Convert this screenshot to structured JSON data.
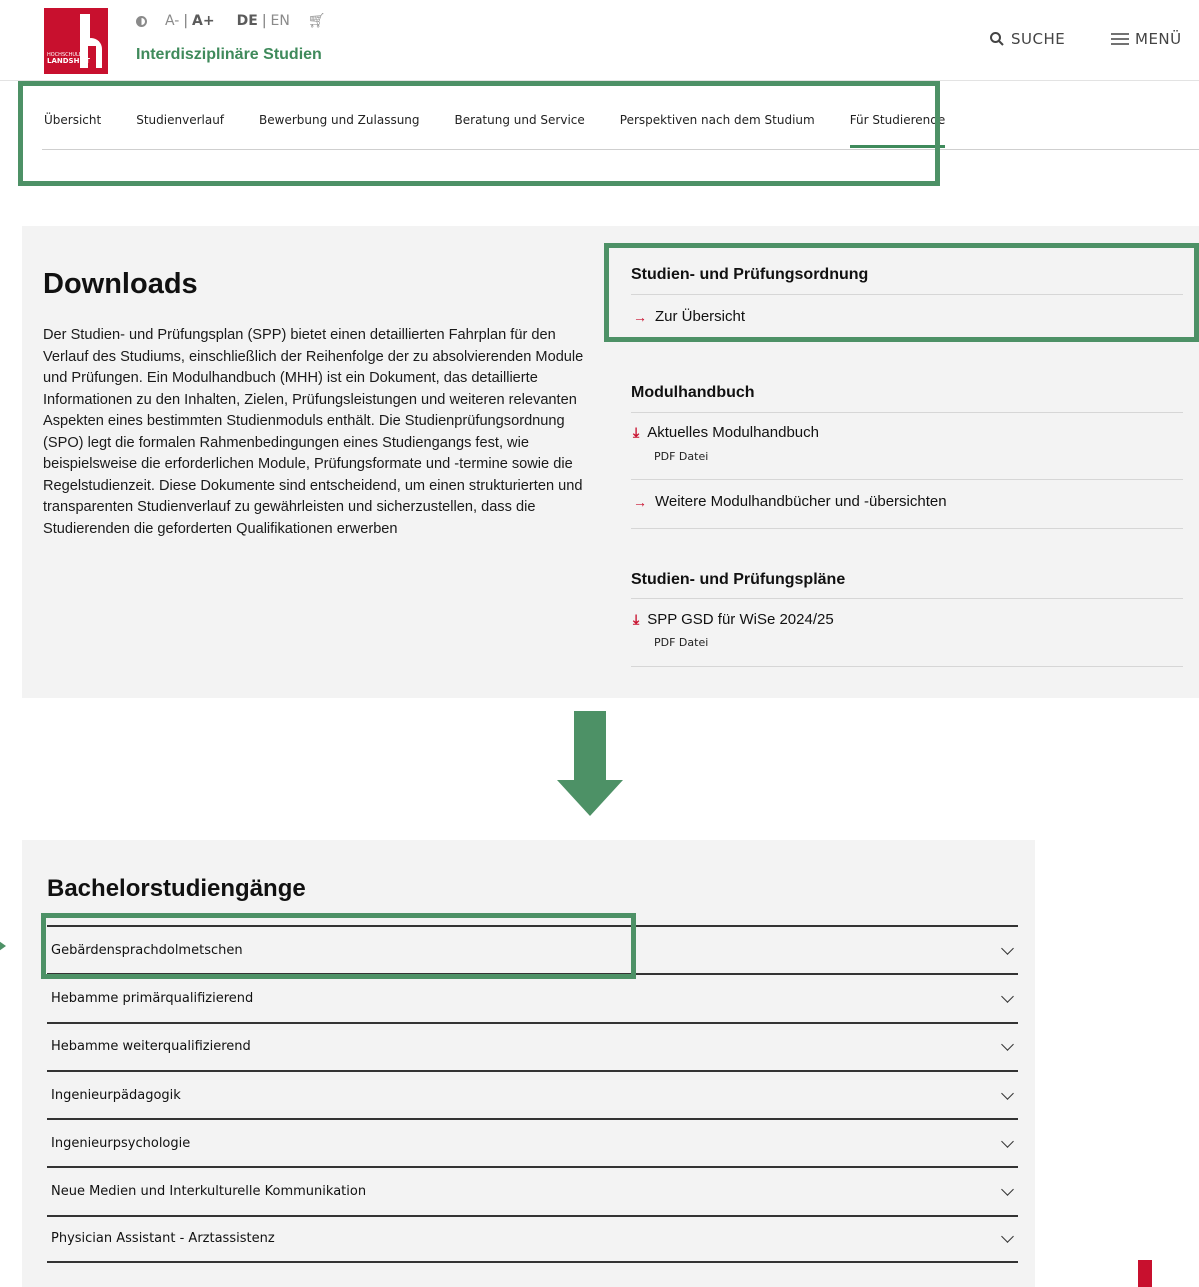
{
  "header": {
    "logo_text_line1": "HOCHSCHULE",
    "logo_text_line2": "LANDSHUT",
    "font_decrease": "A-",
    "font_increase": "A+",
    "lang_de": "DE",
    "lang_en": "EN",
    "site_title": "Interdisziplinäre Studien",
    "search_label": "SUCHE",
    "menu_label": "MENÜ"
  },
  "nav": {
    "items": [
      {
        "label": "Übersicht"
      },
      {
        "label": "Studienverlauf"
      },
      {
        "label": "Bewerbung und Zulassung"
      },
      {
        "label": "Beratung und Service"
      },
      {
        "label": "Perspektiven nach dem Studium"
      },
      {
        "label": "Für Studierende"
      }
    ],
    "active_index": 5
  },
  "downloads": {
    "title": "Downloads",
    "text": "Der Studien- und Prüfungsplan (SPP) bietet einen detaillierten Fahrplan für den Verlauf des Studiums, einschließlich der Reihenfolge der zu absolvierenden Module und Prüfungen. Ein Modulhandbuch (MHH) ist ein Dokument, das detaillierte Informationen zu den Inhalten, Zielen, Prüfungsleistungen und weiteren relevanten Aspekten eines bestimmten Studienmoduls enthält. Die Studienprüfungsordnung (SPO) legt die formalen Rahmenbedingungen eines Studiengangs fest, wie beispielsweise die erforderlichen Module, Prüfungsformate und -termine sowie die Regelstudienzeit. Diese Dokumente sind entscheidend, um einen strukturierten und transparenten Studienverlauf zu gewährleisten und sicherzustellen, dass die Studierenden die geforderten Qualifikationen erwerben",
    "spo_heading": "Studien- und Prüfungsordnung",
    "spo_link": "Zur Übersicht",
    "mhh_heading": "Modulhandbuch",
    "mhh_file": "Aktuelles Modulhandbuch",
    "mhh_file_type": "PDF Datei",
    "mhh_link": "Weitere Modulhandbücher und -übersichten",
    "spp_heading": "Studien- und Prüfungspläne",
    "spp_file": "SPP GSD für WiSe 2024/25",
    "spp_file_type": "PDF Datei"
  },
  "bachelor": {
    "title": "Bachelorstudiengänge",
    "programs": [
      "Gebärdensprachdolmetschen",
      "Hebamme primärqualifizierend",
      "Hebamme weiterqualifizierend",
      "Ingenieurpädagogik",
      "Ingenieurpsychologie",
      "Neue Medien und Interkulturelle Kommunikation",
      "Physician Assistant - Arztassistenz"
    ]
  },
  "colors": {
    "brand_red": "#c8102e",
    "accent_green": "#3f8a5b",
    "highlight_green": "#4d9166",
    "panel_gray": "#f3f3f3"
  }
}
